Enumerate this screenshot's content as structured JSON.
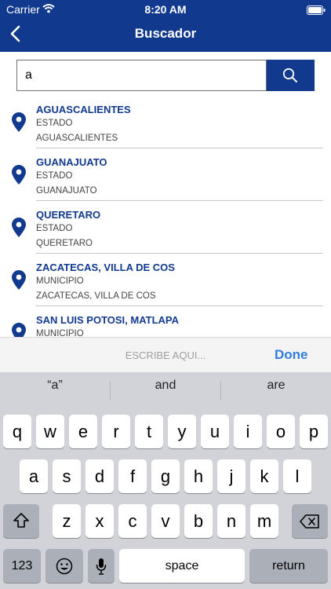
{
  "status_bar": {
    "carrier": "Carrier",
    "time": "8:20 AM"
  },
  "nav": {
    "title": "Buscador",
    "back_icon": "chevron-left-icon"
  },
  "search": {
    "value": "a",
    "button_icon": "magnifier-icon"
  },
  "results": [
    {
      "name": "AGUASCALIENTES",
      "type": "ESTADO",
      "detail": "AGUASCALIENTES"
    },
    {
      "name": "GUANAJUATO",
      "type": "ESTADO",
      "detail": "GUANAJUATO"
    },
    {
      "name": "QUERETARO",
      "type": "ESTADO",
      "detail": "QUERETARO"
    },
    {
      "name": "ZACATECAS, VILLA DE COS",
      "type": "MUNICIPIO",
      "detail": "ZACATECAS, VILLA DE COS"
    },
    {
      "name": "SAN LUIS POTOSI, MATLAPA",
      "type": "MUNICIPIO",
      "detail": ""
    }
  ],
  "accessory": {
    "hint": "ESCRIBE AQUI...",
    "done": "Done"
  },
  "keyboard": {
    "suggestions": [
      "“a”",
      "and",
      "are"
    ],
    "row1": [
      "q",
      "w",
      "e",
      "r",
      "t",
      "y",
      "u",
      "i",
      "o",
      "p"
    ],
    "row2": [
      "a",
      "s",
      "d",
      "f",
      "g",
      "h",
      "j",
      "k",
      "l"
    ],
    "row3": [
      "z",
      "x",
      "c",
      "v",
      "b",
      "n",
      "m"
    ],
    "numbers": "123",
    "space": "space",
    "return": "return"
  },
  "colors": {
    "brand": "#113a8f",
    "done": "#2f7de1"
  }
}
